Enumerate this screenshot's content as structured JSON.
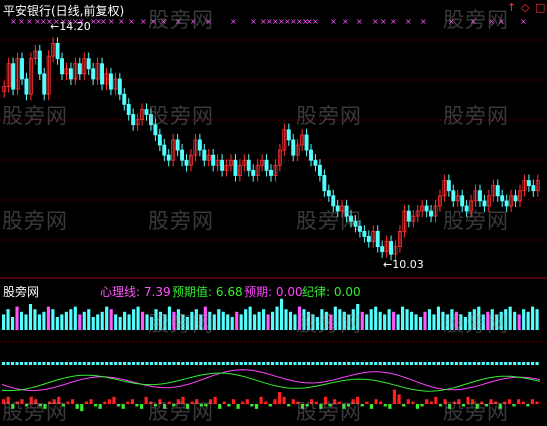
{
  "header": {
    "stock_title": "平安银行(日线,前复权)",
    "panel_title": "股旁网",
    "indicators": [
      {
        "key": "心理线:",
        "value": "7.39"
      },
      {
        "key": "预期值:",
        "value": "6.68"
      },
      {
        "key": "预期:",
        "value": "0.00"
      },
      {
        "key": "纪律:",
        "value": "0.00"
      }
    ],
    "corner_icons": [
      "up-arrow-icon",
      "diamond-icon",
      "square-icon"
    ]
  },
  "watermark": "股旁网",
  "colors": {
    "up": "#ff3232",
    "down": "#54ffff",
    "grid": "#8b0000",
    "marker": "#ff55ff",
    "line_magenta": "#ff44ff",
    "line_green": "#33ee33",
    "volume": "#54ffff"
  },
  "chart_data": {
    "type": "candlestick",
    "high_annotation": {
      "label": "14.20",
      "value": 14.2
    },
    "low_annotation": {
      "label": "10.03",
      "value": 10.03
    },
    "price_series": [
      13.35,
      13.8,
      13.3,
      13.9,
      13.5,
      13.2,
      13.9,
      14.05,
      13.6,
      13.2,
      13.95,
      14.2,
      13.9,
      13.6,
      13.7,
      13.5,
      13.8,
      13.6,
      13.9,
      13.7,
      13.5,
      13.8,
      13.4,
      13.6,
      13.3,
      13.5,
      13.2,
      13.0,
      12.8,
      12.6,
      12.7,
      12.9,
      12.8,
      12.6,
      12.4,
      12.2,
      12.0,
      11.9,
      12.3,
      12.1,
      11.9,
      11.8,
      12.0,
      12.3,
      12.1,
      11.9,
      12.0,
      11.8,
      11.9,
      11.7,
      11.8,
      11.9,
      11.6,
      11.8,
      11.9,
      11.7,
      11.6,
      11.8,
      11.9,
      11.7,
      11.6,
      11.8,
      12.1,
      12.5,
      12.3,
      12.0,
      12.2,
      12.4,
      12.1,
      11.9,
      11.8,
      11.6,
      11.3,
      11.2,
      11.0,
      10.9,
      11.0,
      10.8,
      10.7,
      10.6,
      10.5,
      10.4,
      10.3,
      10.5,
      10.2,
      10.1,
      10.3,
      10.05,
      10.2,
      10.5,
      10.9,
      10.7,
      10.8,
      10.9,
      11.0,
      10.9,
      10.8,
      11.0,
      11.2,
      11.5,
      11.3,
      11.1,
      11.2,
      11.0,
      10.9,
      11.1,
      11.3,
      11.1,
      11.0,
      11.2,
      11.4,
      11.2,
      11.1,
      11.0,
      11.2,
      11.1,
      11.3,
      11.5,
      11.4,
      11.3,
      11.5
    ],
    "volume_series": [
      6,
      8,
      5,
      9,
      7,
      6,
      10,
      8,
      6,
      7,
      9,
      8,
      5,
      6,
      7,
      8,
      9,
      6,
      7,
      8,
      5,
      6,
      7,
      9,
      8,
      6,
      5,
      7,
      6,
      8,
      9,
      7,
      6,
      5,
      8,
      7,
      6,
      9,
      7,
      8,
      6,
      5,
      7,
      8,
      6,
      9,
      7,
      6,
      8,
      7,
      6,
      5,
      7,
      6,
      8,
      9,
      6,
      7,
      8,
      6,
      7,
      9,
      12,
      8,
      7,
      6,
      9,
      8,
      7,
      6,
      5,
      8,
      7,
      6,
      9,
      8,
      7,
      6,
      8,
      10,
      7,
      6,
      8,
      9,
      7,
      6,
      8,
      7,
      6,
      9,
      8,
      7,
      6,
      5,
      7,
      8,
      6,
      9,
      7,
      6,
      8,
      7,
      6,
      5,
      7,
      8,
      9,
      6,
      7,
      8,
      6,
      7,
      8,
      9,
      7,
      6,
      8,
      7,
      9,
      8
    ],
    "bar_series": [
      2,
      3,
      -2,
      1,
      2,
      -1,
      3,
      2,
      -1,
      -2,
      1,
      2,
      3,
      -1,
      1,
      2,
      -2,
      -3,
      1,
      2,
      -1,
      -2,
      1,
      2,
      3,
      -1,
      -2,
      1,
      2,
      -1,
      -2,
      3,
      1,
      -1,
      2,
      -2,
      1,
      -1,
      2,
      3,
      -2,
      1,
      2,
      -1,
      -1,
      2,
      3,
      -2,
      1,
      -1,
      2,
      -2,
      1,
      2,
      -1,
      -2,
      3,
      1,
      -1,
      2,
      5,
      3,
      -1,
      2,
      1,
      -2,
      -1,
      2,
      1,
      -2,
      3,
      -1,
      2,
      1,
      -2,
      -1,
      2,
      3,
      -1,
      1,
      -2,
      2,
      1,
      -1,
      -2,
      6,
      4,
      -1,
      2,
      1,
      -2,
      -1,
      2,
      1,
      3,
      -1,
      2,
      -2,
      1,
      2,
      -1,
      3,
      2,
      -2,
      1,
      -1,
      2,
      1,
      -2,
      1,
      2,
      -1,
      2,
      1,
      -1,
      2,
      1
    ]
  }
}
